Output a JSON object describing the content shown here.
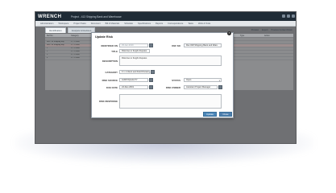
{
  "app": {
    "logo": "WRENCH",
    "project_title": "Project - 413 Shipping Bank and Warehouse"
  },
  "toolbar": {
    "items": [
      "Administration",
      "Workspace",
      "Project Tasks",
      "Document",
      "Bill of Materials",
      "Schedule",
      "Specifications",
      "Reports",
      "Correspondence",
      "Tasks",
      "Work & Tools"
    ]
  },
  "tabs": [
    "Identification",
    "Analysis & Revision"
  ],
  "actions": [
    "Preview",
    "Export",
    "Process Content Down"
  ],
  "grid": {
    "headers": [
      "Ref No",
      "Category",
      "Description",
      "Status",
      "Date",
      "Owner",
      "Source",
      "Due",
      "Type",
      "Action"
    ],
    "rows": [
      [
        "",
        "",
        "",
        "",
        "",
        "",
        "",
        "",
        "",
        ""
      ],
      [
        "Rev #18 Shipping Bay",
        "F 1 1 Dime",
        "",
        "",
        "",
        "",
        "",
        "",
        "",
        ""
      ],
      [
        "Rev #18 Shipping Bay",
        "F 1 1 Dime",
        "",
        "",
        "",
        "",
        "",
        "",
        "",
        ""
      ],
      [
        "1",
        "F 1 1 Dime",
        "",
        "",
        "",
        "",
        "",
        "",
        "",
        ""
      ],
      [
        "2",
        "F 1 1 Dime",
        "",
        "",
        "",
        "",
        "",
        "",
        "",
        ""
      ],
      [
        "3",
        "F 1 1 Dime",
        "",
        "",
        "",
        "",
        "",
        "",
        "",
        ""
      ],
      [
        "4",
        "F 1 1 Dime",
        "",
        "",
        "",
        "",
        "",
        "",
        "",
        ""
      ]
    ],
    "selected_row": 2
  },
  "dialog": {
    "title": "Update Risk",
    "close_glyph": "×",
    "identified_on_label": "IDENTIFIED ON",
    "identified_on_value": "29-Jan-2019",
    "ref_no_label": "REF NO",
    "ref_no_value": "Rev #18 Shipping Bank and Ware",
    "title_label": "TITLE",
    "title_value": "Risk due to freight disputes",
    "description_label": "DESCRIPTION",
    "description_value": "Risk due to freight disputes",
    "category_label": "CATEGORY",
    "category_value": "F 1 1 Client and Field Division",
    "risk_source_label": "RISK SOURCE",
    "risk_source_value": "AUDIT/QUALITY",
    "status_label": "STATUS",
    "status_value": "Open",
    "due_date_label": "DUE DATE",
    "due_date_value": "24-Dec-2019",
    "risk_owner_label": "RISK OWNER",
    "risk_owner_value": "Assistant Project Manager",
    "risk_response_label": "RISK RESPONSE",
    "risk_response_value": "",
    "update_button": "Update",
    "close_button": "Close"
  },
  "colors": {
    "titlebar": "#1f2b36",
    "button": "#4c87b9",
    "overlay": "#6f7073"
  }
}
